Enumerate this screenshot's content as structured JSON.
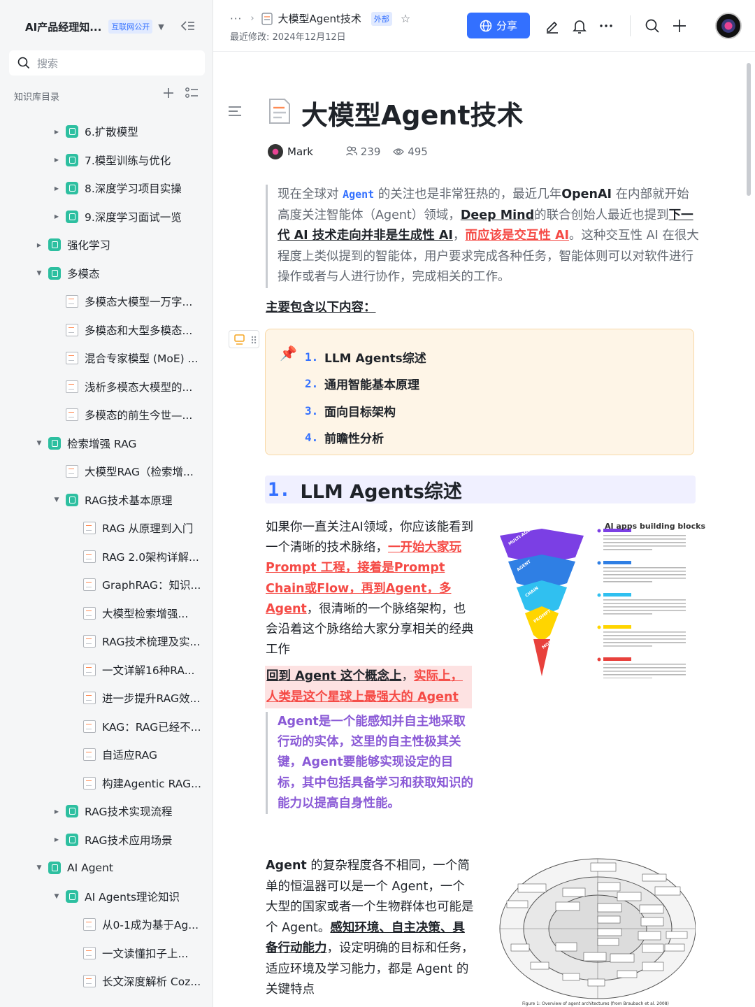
{
  "sidebar": {
    "kb_title": "AI产品经理知...",
    "kb_badge": "互联网公开",
    "search_placeholder": "搜索",
    "section_label": "知识库目录",
    "items": [
      {
        "label": "6.扩散模型",
        "type": "kb",
        "level": 1,
        "arrow": "right"
      },
      {
        "label": "7.模型训练与优化",
        "type": "kb",
        "level": 1,
        "arrow": "right"
      },
      {
        "label": "8.深度学习项目实操",
        "type": "kb",
        "level": 1,
        "arrow": "right"
      },
      {
        "label": "9.深度学习面试一览",
        "type": "kb",
        "level": 1,
        "arrow": "right"
      },
      {
        "label": "强化学习",
        "type": "kb",
        "level": 0,
        "arrow": "right"
      },
      {
        "label": "多模态",
        "type": "kb",
        "level": 0,
        "arrow": "down"
      },
      {
        "label": "多模态大模型一万字...",
        "type": "doc",
        "level": 1,
        "arrow": ""
      },
      {
        "label": "多模态和大型多模态...",
        "type": "doc",
        "level": 1,
        "arrow": ""
      },
      {
        "label": "混合专家模型 (MoE) ...",
        "type": "doc",
        "level": 1,
        "arrow": ""
      },
      {
        "label": "浅析多模态大模型的...",
        "type": "doc",
        "level": 1,
        "arrow": ""
      },
      {
        "label": "多模态的前生今世—...",
        "type": "doc",
        "level": 1,
        "arrow": ""
      },
      {
        "label": "检索增强 RAG",
        "type": "kb",
        "level": 0,
        "arrow": "down"
      },
      {
        "label": "大模型RAG（检索增...",
        "type": "doc",
        "level": 1,
        "arrow": ""
      },
      {
        "label": "RAG技术基本原理",
        "type": "kb",
        "level": 1,
        "arrow": "down"
      },
      {
        "label": "RAG 从原理到入门",
        "type": "doc",
        "level": 2,
        "arrow": ""
      },
      {
        "label": "RAG 2.0架构详解...",
        "type": "doc",
        "level": 2,
        "arrow": ""
      },
      {
        "label": "GraphRAG：知识...",
        "type": "doc",
        "level": 2,
        "arrow": ""
      },
      {
        "label": "大模型检索增强...",
        "type": "doc",
        "level": 2,
        "arrow": ""
      },
      {
        "label": "RAG技术梳理及实...",
        "type": "doc",
        "level": 2,
        "arrow": ""
      },
      {
        "label": "一文详解16种RA...",
        "type": "doc",
        "level": 2,
        "arrow": ""
      },
      {
        "label": "进一步提升RAG效...",
        "type": "doc",
        "level": 2,
        "arrow": ""
      },
      {
        "label": "KAG：RAG已经不...",
        "type": "doc",
        "level": 2,
        "arrow": ""
      },
      {
        "label": "自适应RAG",
        "type": "doc",
        "level": 2,
        "arrow": ""
      },
      {
        "label": "构建Agentic RAG...",
        "type": "doc",
        "level": 2,
        "arrow": ""
      },
      {
        "label": "RAG技术实现流程",
        "type": "kb",
        "level": 1,
        "arrow": "right"
      },
      {
        "label": "RAG技术应用场景",
        "type": "kb",
        "level": 1,
        "arrow": "right"
      },
      {
        "label": "AI Agent",
        "type": "kb",
        "level": 0,
        "arrow": "down"
      },
      {
        "label": "AI Agents理论知识",
        "type": "kb",
        "level": 1,
        "arrow": "down"
      },
      {
        "label": "从0-1成为基于Ag...",
        "type": "doc",
        "level": 2,
        "arrow": ""
      },
      {
        "label": "一文读懂扣子上...",
        "type": "doc",
        "level": 2,
        "arrow": ""
      },
      {
        "label": "长文深度解析 Coz...",
        "type": "doc",
        "level": 2,
        "arrow": ""
      }
    ]
  },
  "topbar": {
    "dots": "···",
    "doc_name": "大模型Agent技术",
    "ext_badge": "外部",
    "modified": "最近修改: 2024年12月12日",
    "share_label": "分享"
  },
  "doc": {
    "title": "大模型Agent技术",
    "author": "Mark",
    "members": "239",
    "views": "495",
    "intro": {
      "p1": "现在全球对 ",
      "code": "Agent",
      "p2": " 的关注也是非常狂热的，最近几年",
      "openai": "OpenAI",
      "p3": " 在内部就开始高度关注智能体（Agent）领域，",
      "deepmind": "Deep Mind",
      "p4": "的联合创始人最近也提到",
      "u1": "下一代 AI 技术走向并非是生成性 AI",
      "p5": "，",
      "u2": "而应该是交互性 AI",
      "p6": "。这种交互性 AI 在很大程度上类似提到的智能体，用户要求完成各种任务，智能体则可以对软件进行操作或者与人进行协作，完成相关的工作。"
    },
    "subhead": "主要包含以下内容：",
    "toc": [
      {
        "num": "1.",
        "label": "LLM Agents综述"
      },
      {
        "num": "2.",
        "label": "通用智能基本原理"
      },
      {
        "num": "3.",
        "label": "面向目标架构"
      },
      {
        "num": "4.",
        "label": "前瞻性分析"
      }
    ],
    "h1_num": "1.",
    "h1_text": "LLM Agents综述",
    "para1": {
      "a": "如果你一直关注AI领域，你应该能看到一个清晰的技术脉络，",
      "red": "一开始大家玩Prompt 工程，接着是Prompt Chain或Flow，再到Agent，多Agent",
      "b": "，很清晰的一个脉络架构，也会沿着这个脉络给大家分享相关的经典工作"
    },
    "highlight": {
      "a": "回到 Agent 这个概念上",
      "sep": "，",
      "b": "实际上，人类是这个星球上最强大的 Agent"
    },
    "quote2": "Agent是一个能感知并自主地采取行动的实体，这里的自主性极其关键，Agent要能够实现设定的目标，其中包括具备学习和获取知识的能力以提高自身性能。",
    "para2": {
      "a": "Agent",
      "b": " 的复杂程度各不相同，一个简单的恒温器可以是一个 Agent，一个大型的国家或者一个生物群体也可能是个 Agent。",
      "u": "感知环境、自主决策、具备行动能力",
      "c": "，设定明确的目标和任务，适应环境及学习能力，都是 Agent 的关键特点"
    },
    "image1": {
      "title": "AI apps building blocks",
      "layers": [
        "MULTI-AGENT",
        "AGENT",
        "CHAIN",
        "PROMPT",
        "MODEL"
      ],
      "colors": [
        "#7b3fe4",
        "#2f7fe4",
        "#30c0f0",
        "#ffd500",
        "#e8413c"
      ]
    },
    "image2": {
      "caption": "Figure 1: Overview of agent architectures (from Braubach et al. 2008)"
    }
  }
}
